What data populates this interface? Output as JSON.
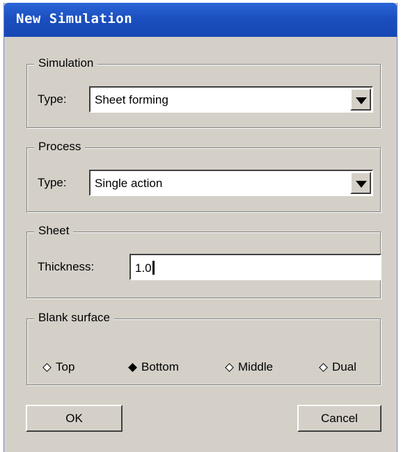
{
  "window": {
    "title": "New Simulation"
  },
  "simulation": {
    "legend": "Simulation",
    "type_label": "Type:",
    "type_value": "Sheet forming"
  },
  "process": {
    "legend": "Process",
    "type_label": "Type:",
    "type_value": "Single action"
  },
  "sheet": {
    "legend": "Sheet",
    "thickness_label": "Thickness:",
    "thickness_value": "1.0"
  },
  "blank_surface": {
    "legend": "Blank surface",
    "options": [
      {
        "label": "Top",
        "selected": false
      },
      {
        "label": "Bottom",
        "selected": true
      },
      {
        "label": "Middle",
        "selected": false
      },
      {
        "label": "Dual",
        "selected": false
      }
    ]
  },
  "buttons": {
    "ok": "OK",
    "cancel": "Cancel"
  },
  "icons": {
    "dropdown": "chevron-down-icon"
  }
}
